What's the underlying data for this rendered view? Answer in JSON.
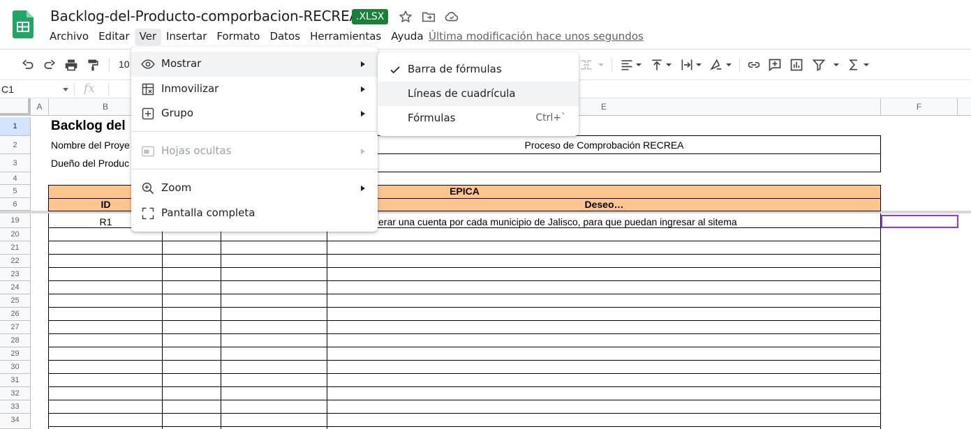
{
  "app": {
    "doc_title": "Backlog-del-Producto-comporbacion-RECREA",
    "file_badge": ".XLSX",
    "last_modified": "Última modificación hace unos segundos"
  },
  "menubar": {
    "items": [
      "Archivo",
      "Editar",
      "Ver",
      "Insertar",
      "Formato",
      "Datos",
      "Herramientas",
      "Ayuda"
    ]
  },
  "toolbar": {
    "zoom": "10"
  },
  "formula_bar": {
    "name_box": "C1",
    "fx": "fx"
  },
  "grid": {
    "columns": [
      "A",
      "B",
      "E",
      "F"
    ],
    "rows": [
      "1",
      "2",
      "3",
      "4",
      "5",
      "6",
      "19",
      "20",
      "21",
      "22",
      "23",
      "24",
      "25",
      "26",
      "27",
      "28",
      "29",
      "30",
      "31",
      "32",
      "33",
      "34"
    ],
    "cells": {
      "b1": "Backlog del",
      "b2": "Nombre del Proye",
      "b3": "Dueño del Produc",
      "e2": "Proceso de Comprobación RECREA",
      "epica": "EPICA",
      "id": "ID",
      "deseo": "Deseo…",
      "r1_id": "R1",
      "r1_desc": "erar una cuenta por cada municipio de Jalisco, para que puedan ingresar al sitema"
    },
    "header_fill": "#ffc58c",
    "selection_color": "#9334e6"
  },
  "ver_menu": {
    "items": [
      {
        "label": "Mostrar",
        "icon": "eye-icon"
      },
      {
        "label": "Inmovilizar",
        "icon": "freeze-icon"
      },
      {
        "label": "Grupo",
        "icon": "group-icon"
      },
      {
        "label": "Hojas ocultas",
        "icon": "hidden-sheets-icon",
        "disabled": true
      },
      {
        "label": "Zoom",
        "icon": "zoom-icon"
      },
      {
        "label": "Pantalla completa",
        "icon": "fullscreen-icon"
      }
    ]
  },
  "mostrar_submenu": {
    "items": [
      {
        "label": "Barra de fórmulas",
        "checked": true
      },
      {
        "label": "Líneas de cuadrícula",
        "checked": false
      },
      {
        "label": "Fórmulas",
        "shortcut": "Ctrl+`"
      }
    ]
  }
}
